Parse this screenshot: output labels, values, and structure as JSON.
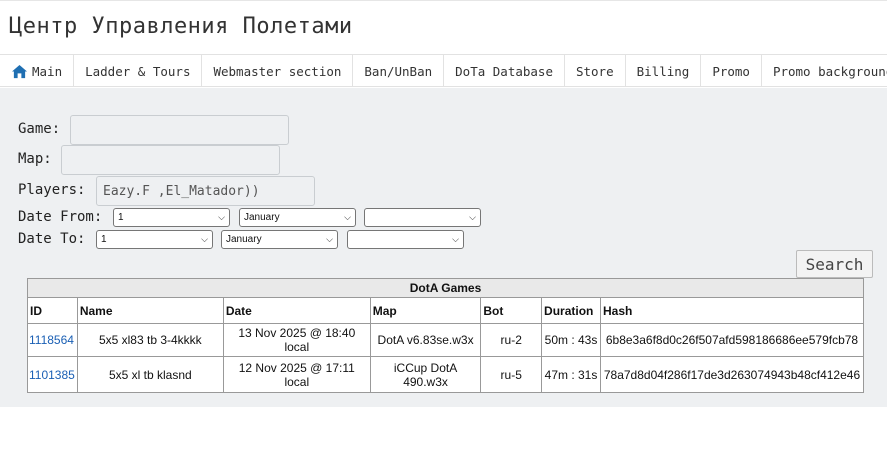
{
  "header": {
    "title": "Центр Управления Полетами"
  },
  "nav": {
    "items": [
      {
        "label": "Main",
        "icon": "home-icon"
      },
      {
        "label": "Ladder & Tours"
      },
      {
        "label": "Webmaster section"
      },
      {
        "label": "Ban/UnBan"
      },
      {
        "label": "DoTa Database"
      },
      {
        "label": "Store"
      },
      {
        "label": "Billing"
      },
      {
        "label": "Promo"
      },
      {
        "label": "Promo background"
      }
    ]
  },
  "form": {
    "game_label": "Game:",
    "game_value": "",
    "map_label": "Map:",
    "map_value": "",
    "players_label": "Players:",
    "players_value": "Eazy.F ,El_Matador))",
    "date_from_label": "Date From:",
    "date_from": {
      "day": "1",
      "month": "January",
      "year": ""
    },
    "date_to_label": "Date To:",
    "date_to": {
      "day": "1",
      "month": "January",
      "year": ""
    },
    "search_label": "Search"
  },
  "table": {
    "caption": "DotA Games",
    "columns": [
      "ID",
      "Name",
      "Date",
      "Map",
      "Bot",
      "Duration",
      "Hash"
    ],
    "rows": [
      {
        "id": "1118564",
        "name": "5x5 xl83 tb 3-4kkkk",
        "date": "13 Nov 2025 @ 18:40 local",
        "map": "DotA v6.83se.w3x",
        "bot": "ru-2",
        "duration": "50m : 43s",
        "hash": "6b8e3a6f8d0c26f507afd598186686ee579fcb78"
      },
      {
        "id": "1101385",
        "name": "5x5 xl tb klasnd",
        "date": "12 Nov 2025 @ 17:11 local",
        "map": "iCCup DotA 490.w3x",
        "bot": "ru-5",
        "duration": "47m : 31s",
        "hash": "78a7d8d04f286f17de3d263074943b48cf412e46"
      }
    ]
  },
  "colors": {
    "link": "#1a5fb4",
    "icon": "#1f6fb2",
    "panel_bg": "#eef0f2"
  }
}
